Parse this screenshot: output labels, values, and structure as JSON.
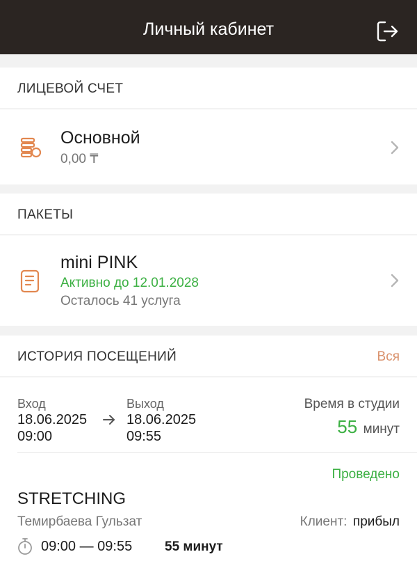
{
  "header": {
    "title": "Личный кабинет"
  },
  "account": {
    "section_title": "ЛИЦЕВОЙ СЧЕТ",
    "name": "Основной",
    "balance": "0,00 ₸"
  },
  "packages": {
    "section_title": "ПАКЕТЫ",
    "name": "mini PINK",
    "status": "Активно до 12.01.2028",
    "remaining": "Осталось 41 услуга"
  },
  "history": {
    "section_title": "ИСТОРИЯ ПОСЕЩЕНИЙ",
    "all_link": "Вся",
    "visit": {
      "in_label": "Вход",
      "in_date": "18.06.2025",
      "in_time": "09:00",
      "out_label": "Выход",
      "out_date": "18.06.2025",
      "out_time": "09:55",
      "duration_label": "Время в студии",
      "duration_value": "55",
      "duration_unit": "минут"
    },
    "class": {
      "status": "Проведено",
      "name": "STRETCHING",
      "trainer": "Темирбаева Гульзат",
      "client_label": "Клиент:",
      "client_value": "прибыл",
      "time_range": "09:00 — 09:55",
      "duration": "55 минут"
    }
  },
  "colors": {
    "topbar": "#2b2522",
    "accent_orange": "#e2874f",
    "link_orange": "#d9906a",
    "green": "#3cb043"
  }
}
